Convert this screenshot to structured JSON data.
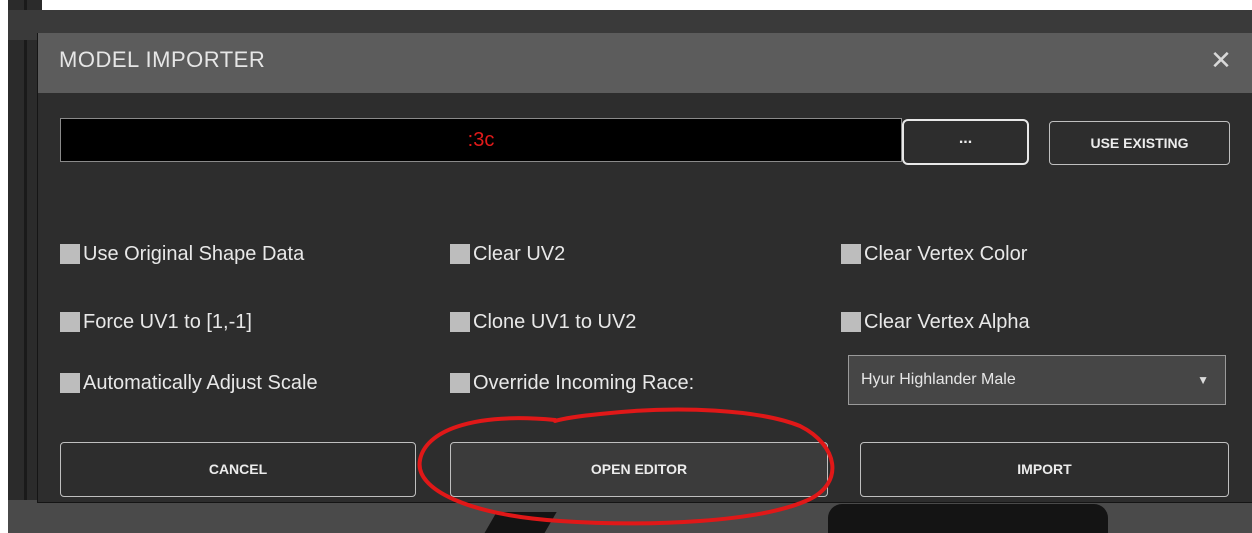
{
  "dialog": {
    "title": "MODEL IMPORTER",
    "close_glyph": "✕"
  },
  "file_path": {
    "value": ":3c",
    "value_color": "#e11a1a"
  },
  "buttons": {
    "browse_label": "...",
    "use_existing_label": "USE EXISTING",
    "cancel_label": "CANCEL",
    "open_editor_label": "OPEN EDITOR",
    "import_label": "IMPORT"
  },
  "options": [
    {
      "label": "Use Original Shape Data",
      "checked": false
    },
    {
      "label": "Clear UV2",
      "checked": false
    },
    {
      "label": "Clear Vertex Color",
      "checked": false
    },
    {
      "label": "Force UV1 to [1,-1]",
      "checked": false
    },
    {
      "label": "Clone UV1 to UV2",
      "checked": false
    },
    {
      "label": "Clear Vertex Alpha",
      "checked": false
    },
    {
      "label": "Automatically Adjust Scale",
      "checked": false
    },
    {
      "label": "Override Incoming Race:",
      "checked": false
    }
  ],
  "race_select": {
    "selected": "Hyur Highlander Male",
    "arrow_icon": "dropdown-arrow"
  },
  "annotation": {
    "color": "#e01818",
    "shape": "hand-drawn circle"
  }
}
